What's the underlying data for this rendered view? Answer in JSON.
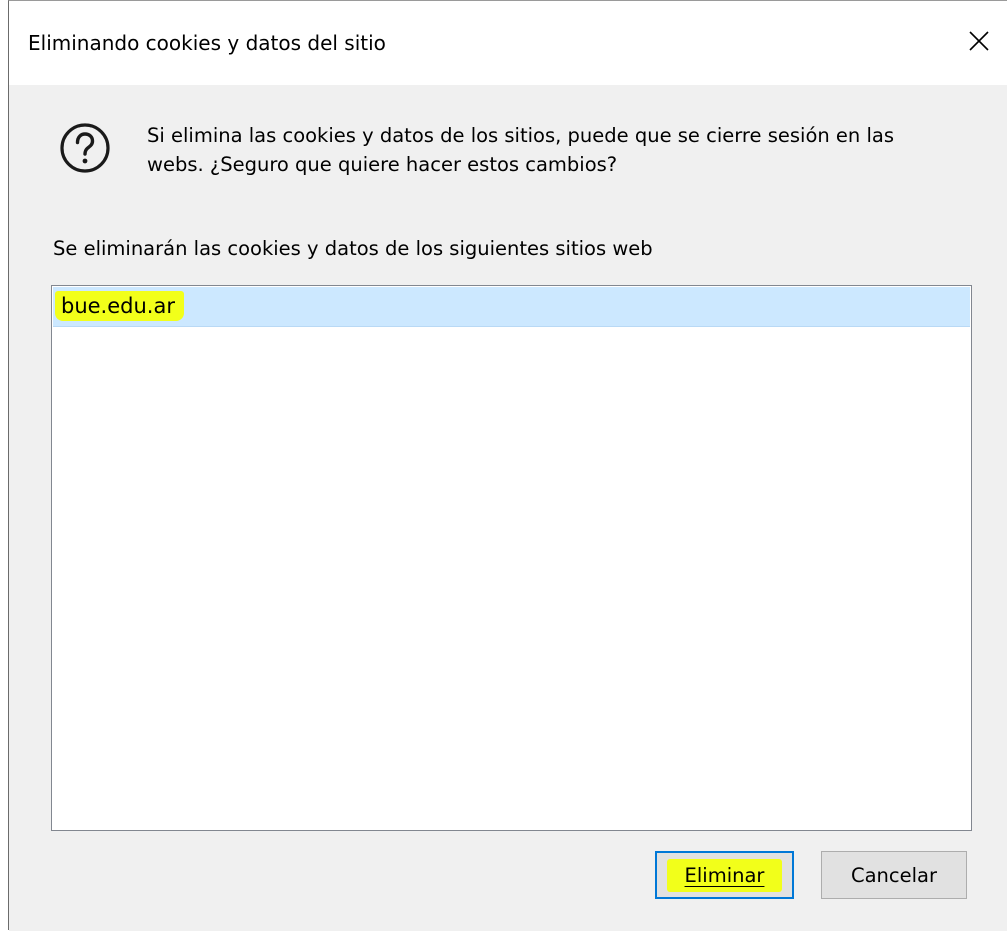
{
  "window": {
    "title": "Eliminando cookies y datos del sitio",
    "close_icon": "close-icon"
  },
  "message": {
    "icon": "question-icon",
    "line1": "Si elimina las cookies y datos de los sitios, puede que se cierre sesión en las",
    "line2": "webs. ¿Seguro que quiere hacer estos cambios?"
  },
  "site_list": {
    "caption": "Se eliminarán las cookies y datos de los siguientes sitios web",
    "items": [
      {
        "label": "bue.edu.ar",
        "selected": true
      }
    ]
  },
  "buttons": {
    "confirm_label": "Eliminar",
    "cancel_label": "Cancelar"
  },
  "colors": {
    "selection": "#cce8ff",
    "highlight": "#f2ff1a",
    "focus_border": "#0078d7",
    "dialog_background": "#f0f0f0"
  }
}
